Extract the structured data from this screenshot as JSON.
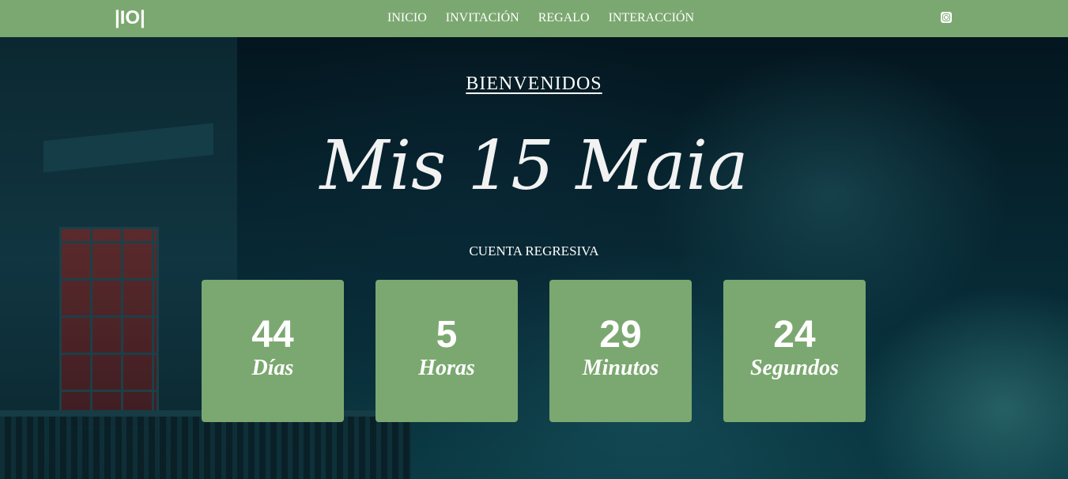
{
  "navbar": {
    "logo": "|IO|",
    "links": [
      "INICIO",
      "INVITACIÓN",
      "REGALO",
      "INTERACCIÓN"
    ],
    "background": "#7ba870"
  },
  "hero": {
    "welcome": "BIENVENIDOS",
    "title": "Mis 15 Maia",
    "countdown_label": "CUENTA REGRESIVA"
  },
  "countdown": [
    {
      "value": "44",
      "unit": "Días"
    },
    {
      "value": "5",
      "unit": "Horas"
    },
    {
      "value": "29",
      "unit": "Minutos"
    },
    {
      "value": "24",
      "unit": "Segundos"
    }
  ],
  "colors": {
    "accent": "#7ba870",
    "text": "#ffffff",
    "sky": "#07222c"
  },
  "icons": {
    "social": "instagram-icon"
  }
}
